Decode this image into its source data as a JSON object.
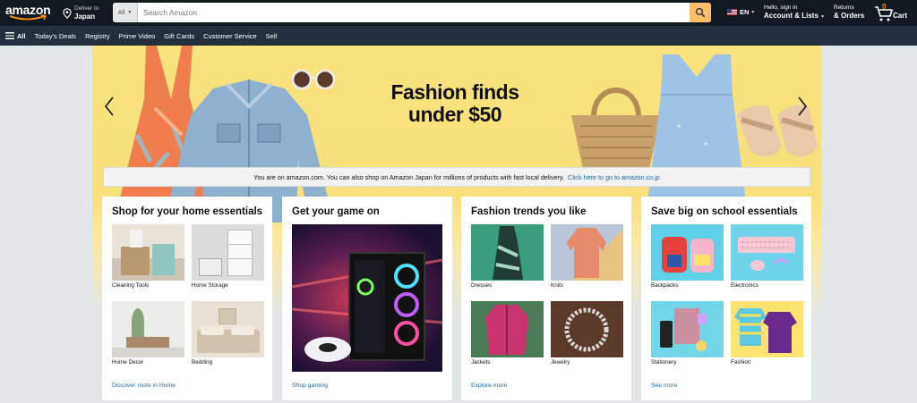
{
  "header": {
    "logo_text": "amazon",
    "deliver_line1": "Deliver to",
    "deliver_line2": "Japan",
    "search_category": "All",
    "search_placeholder": "Search Amazon",
    "language": "EN",
    "account_line1": "Hello, sign in",
    "account_line2": "Account & Lists",
    "returns_line1": "Returns",
    "returns_line2": "& Orders",
    "cart_count": "0",
    "cart_label": "Cart"
  },
  "subnav": {
    "all_label": "All",
    "items": [
      "Today's Deals",
      "Registry",
      "Prime Video",
      "Gift Cards",
      "Customer Service",
      "Sell"
    ]
  },
  "hero": {
    "title_line1": "Fashion finds",
    "title_line2": "under $50",
    "notice_text": "You are on amazon.com. You can also shop on Amazon Japan for millions of products with fast local delivery.",
    "notice_link": "Click here to go to amazon.co.jp"
  },
  "cards": [
    {
      "title": "Shop for your home essentials",
      "tiles": [
        "Cleaning Tools",
        "Home Storage",
        "Home Decor",
        "Bedding"
      ],
      "link": "Discover more in Home"
    },
    {
      "title": "Get your game on",
      "link": "Shop gaming"
    },
    {
      "title": "Fashion trends you like",
      "tiles": [
        "Dresses",
        "Knits",
        "Jackets",
        "Jewelry"
      ],
      "link": "Explore more"
    },
    {
      "title": "Save big on school essentials",
      "tiles": [
        "Backpacks",
        "Electronics",
        "Stationery",
        "Fashion"
      ],
      "link": "See more"
    }
  ],
  "colors": {
    "nav_dark": "#131921",
    "nav_sub": "#232f3e",
    "search_button": "#febd69",
    "hero_yellow": "#f9e37f",
    "link_blue": "#1a6aa5",
    "cart_orange": "#f08804"
  }
}
